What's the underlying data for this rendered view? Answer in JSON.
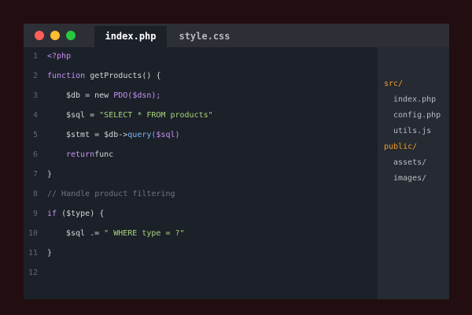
{
  "tabs": [
    {
      "label": "index.php",
      "active": true
    },
    {
      "label": "style.css",
      "active": false
    }
  ],
  "code_lines": [
    {
      "n": "1",
      "tokens": [
        {
          "t": "<?php",
          "c": "kw"
        }
      ]
    },
    {
      "n": "2",
      "tokens": [
        {
          "t": "function ",
          "c": "kw"
        },
        {
          "t": "getProducts() {",
          "c": ""
        }
      ]
    },
    {
      "n": "3",
      "tokens": [
        {
          "t": "$db = new ",
          "c": ""
        },
        {
          "t": "PDO(",
          "c": "kw"
        },
        {
          "t": "$dsn);",
          "c": "kw"
        }
      ]
    },
    {
      "n": "4",
      "tokens": [
        {
          "t": "$sql = ",
          "c": ""
        },
        {
          "t": "\"SELECT * FROM products\"",
          "c": "str"
        }
      ]
    },
    {
      "n": "5",
      "tokens": [
        {
          "t": "$stmt = $db->",
          "c": ""
        },
        {
          "t": "query(",
          "c": "fn"
        },
        {
          "t": "$sql)",
          "c": "kw"
        }
      ]
    },
    {
      "n": "6",
      "tokens": [
        {
          "t": "return",
          "c": "kw"
        },
        {
          "t": "func",
          "c": ""
        }
      ]
    },
    {
      "n": "7",
      "tokens": [
        {
          "t": "}",
          "c": ""
        }
      ]
    },
    {
      "n": "8",
      "tokens": [
        {
          "t": "// Handle product filtering",
          "c": "cm"
        }
      ]
    },
    {
      "n": "9",
      "tokens": [
        {
          "t": "if",
          "c": "kw"
        },
        {
          "t": " ($type) {",
          "c": ""
        }
      ]
    },
    {
      "n": "10",
      "tokens": [
        {
          "t": "$sql .= ",
          "c": ""
        },
        {
          "t": "\" WHERE type = ?\"",
          "c": "str"
        }
      ]
    },
    {
      "n": "11",
      "tokens": [
        {
          "t": "}",
          "c": ""
        }
      ]
    },
    {
      "n": "12",
      "tokens": []
    }
  ],
  "file_tree": [
    {
      "label": "src/",
      "type": "folder"
    },
    {
      "label": "index.php",
      "type": "file"
    },
    {
      "label": "config.php",
      "type": "file"
    },
    {
      "label": "utils.js",
      "type": "file"
    },
    {
      "label": "public/",
      "type": "folder"
    },
    {
      "label": "assets/",
      "type": "file"
    },
    {
      "label": "images/",
      "type": "file"
    }
  ],
  "colors": {
    "background": "#220e10",
    "editor": "#1c2028",
    "sidebar": "#262a33",
    "keyword": "#c694f5",
    "function": "#74b6f6",
    "string": "#a8d37c",
    "comment": "#6e7480",
    "folder": "#ee9d22"
  }
}
